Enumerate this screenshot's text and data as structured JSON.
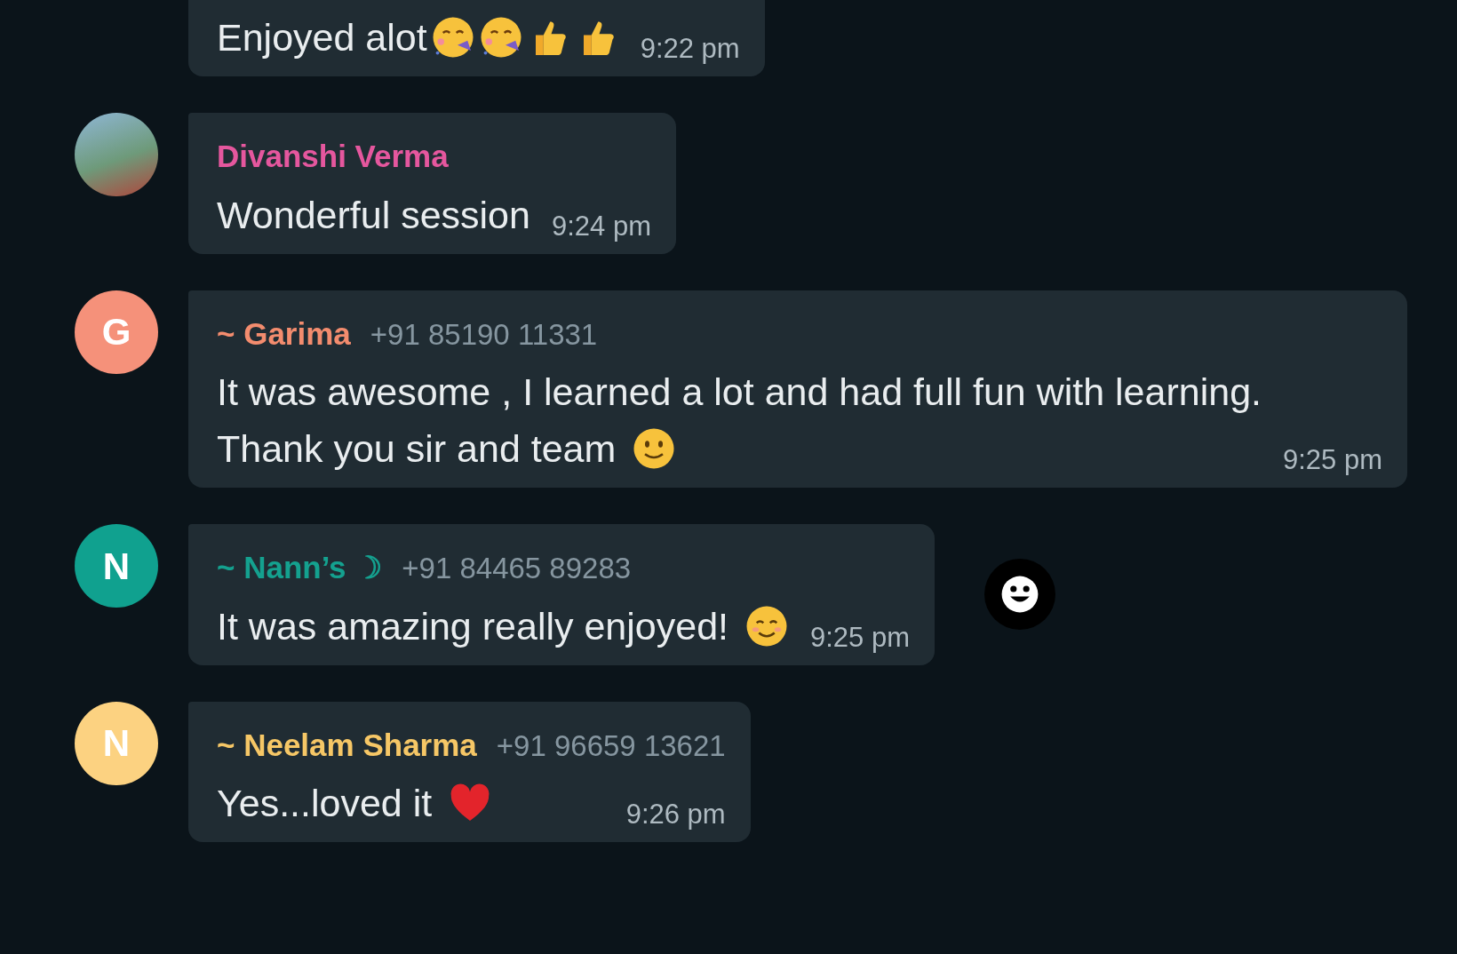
{
  "messages": [
    {
      "kind": "continued",
      "lines": [
        "Enjoyed alot"
      ],
      "emojis": [
        {
          "kind": "partying"
        },
        {
          "kind": "partying"
        },
        {
          "kind": "thumbs_up"
        },
        {
          "kind": "thumbs_up"
        }
      ],
      "time": "9:22 pm"
    },
    {
      "kind": "first",
      "avatar": {
        "kind": "photo"
      },
      "sender": "Divanshi Verma",
      "color": "#e5579e",
      "lines": [
        "Wonderful session"
      ],
      "time": "9:24 pm"
    },
    {
      "kind": "first",
      "avatar": {
        "kind": "letter",
        "letter": "G",
        "color": "#f5917a"
      },
      "sender": "~ Garima",
      "color": "#f38c6e",
      "phone": "+91 85190 11331",
      "lines": [
        "It was awesome , I learned a lot and had full fun with learning.",
        "Thank you sir and team"
      ],
      "emojis": [
        {
          "kind": "slight_smile"
        }
      ],
      "time": "9:25 pm"
    },
    {
      "kind": "first",
      "avatar": {
        "kind": "letter",
        "letter": "N",
        "color": "#10a18f"
      },
      "sender": "~ Nann’s ☽",
      "color": "#14a18f",
      "phone": "+91 84465 89283",
      "lines": [
        "It was amazing really enjoyed!"
      ],
      "emojis": [
        {
          "kind": "blush"
        }
      ],
      "time": "9:25 pm",
      "reaction_button": true
    },
    {
      "kind": "first",
      "avatar": {
        "kind": "letter",
        "letter": "N",
        "color": "#fcd281"
      },
      "sender": "~ Neelam Sharma",
      "color": "#f6c766",
      "phone": "+91 96659 13621",
      "lines": [
        "Yes...loved it"
      ],
      "emojis": [
        {
          "kind": "heart"
        }
      ],
      "time": "9:26 pm"
    }
  ]
}
